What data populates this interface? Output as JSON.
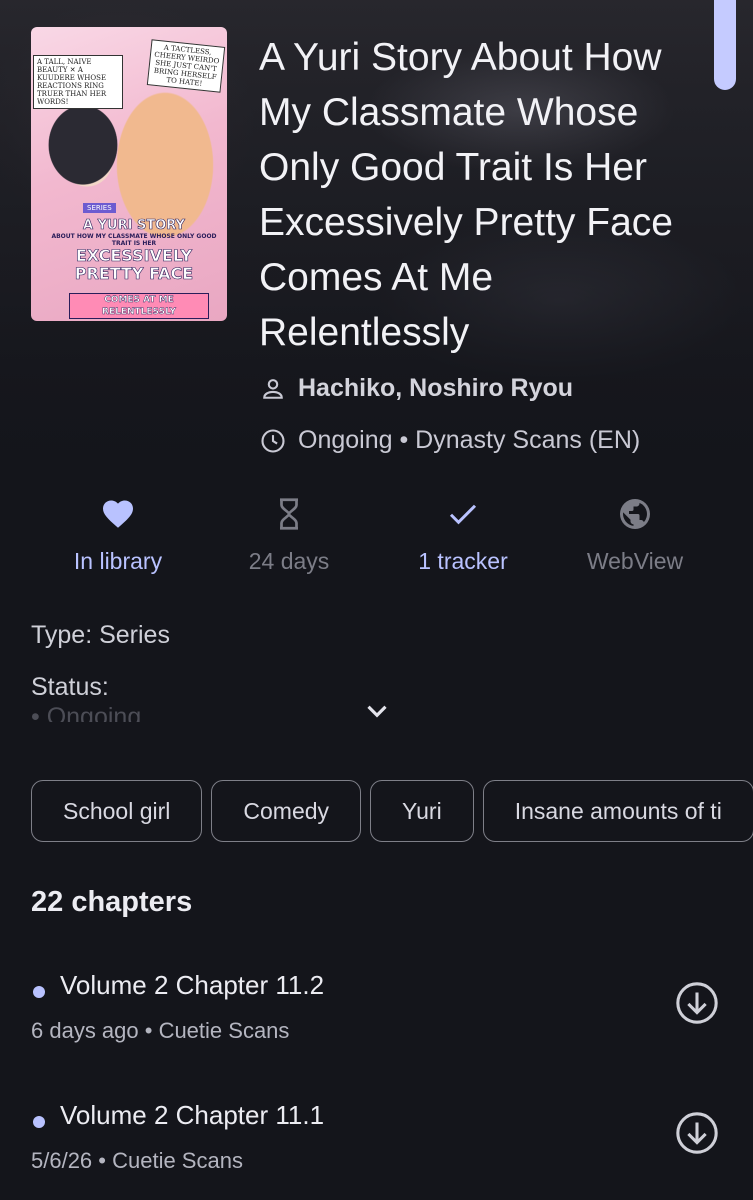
{
  "manga": {
    "title": "A Yuri Story About How My Classmate Whose Only Good Trait Is Her Excessively Pretty Face Comes At Me Relentlessly",
    "author": "Hachiko, Noshiro Ryou",
    "status": "Ongoing",
    "source": "Dynasty Scans (EN)",
    "status_line": "Ongoing • Dynasty Scans (EN)"
  },
  "cover": {
    "tag_left": "A TALL, NAIVE BEAUTY ✕ A KUUDERE WHOSE REACTIONS RING TRUER THAN HER WORDS!",
    "tag_right": "A TACTLESS, CHEERY WEIRDO SHE JUST CAN'T BRING HERSELF TO HATE!",
    "series_label": "SERIES",
    "title_line1": "A YURI STORY",
    "title_small": "ABOUT HOW MY CLASSMATE WHOSE ONLY GOOD TRAIT IS HER",
    "title_line2": "EXCESSIVELY PRETTY FACE",
    "band": "COMES AT ME RELENTLESSLY"
  },
  "actions": [
    {
      "label": "In library",
      "icon": "heart-icon"
    },
    {
      "label": "24 days",
      "icon": "hourglass-icon"
    },
    {
      "label": "1 tracker",
      "icon": "check-icon"
    },
    {
      "label": "WebView",
      "icon": "globe-icon"
    }
  ],
  "description": {
    "type": "Type: Series",
    "status_label": "Status:",
    "status_value": "• Ongoing"
  },
  "genres": [
    "School girl",
    "Comedy",
    "Yuri",
    "Insane amounts of ti"
  ],
  "chapters_count": "22 chapters",
  "chapters": [
    {
      "title": "Volume 2 Chapter 11.2",
      "subtitle": "6 days ago • Cuetie Scans"
    },
    {
      "title": "Volume 2 Chapter 11.1",
      "subtitle": "5/6/26 • Cuetie Scans"
    }
  ],
  "colors": {
    "accent": "#b9c2ff",
    "background": "#14151b",
    "muted": "#7c7d87"
  }
}
